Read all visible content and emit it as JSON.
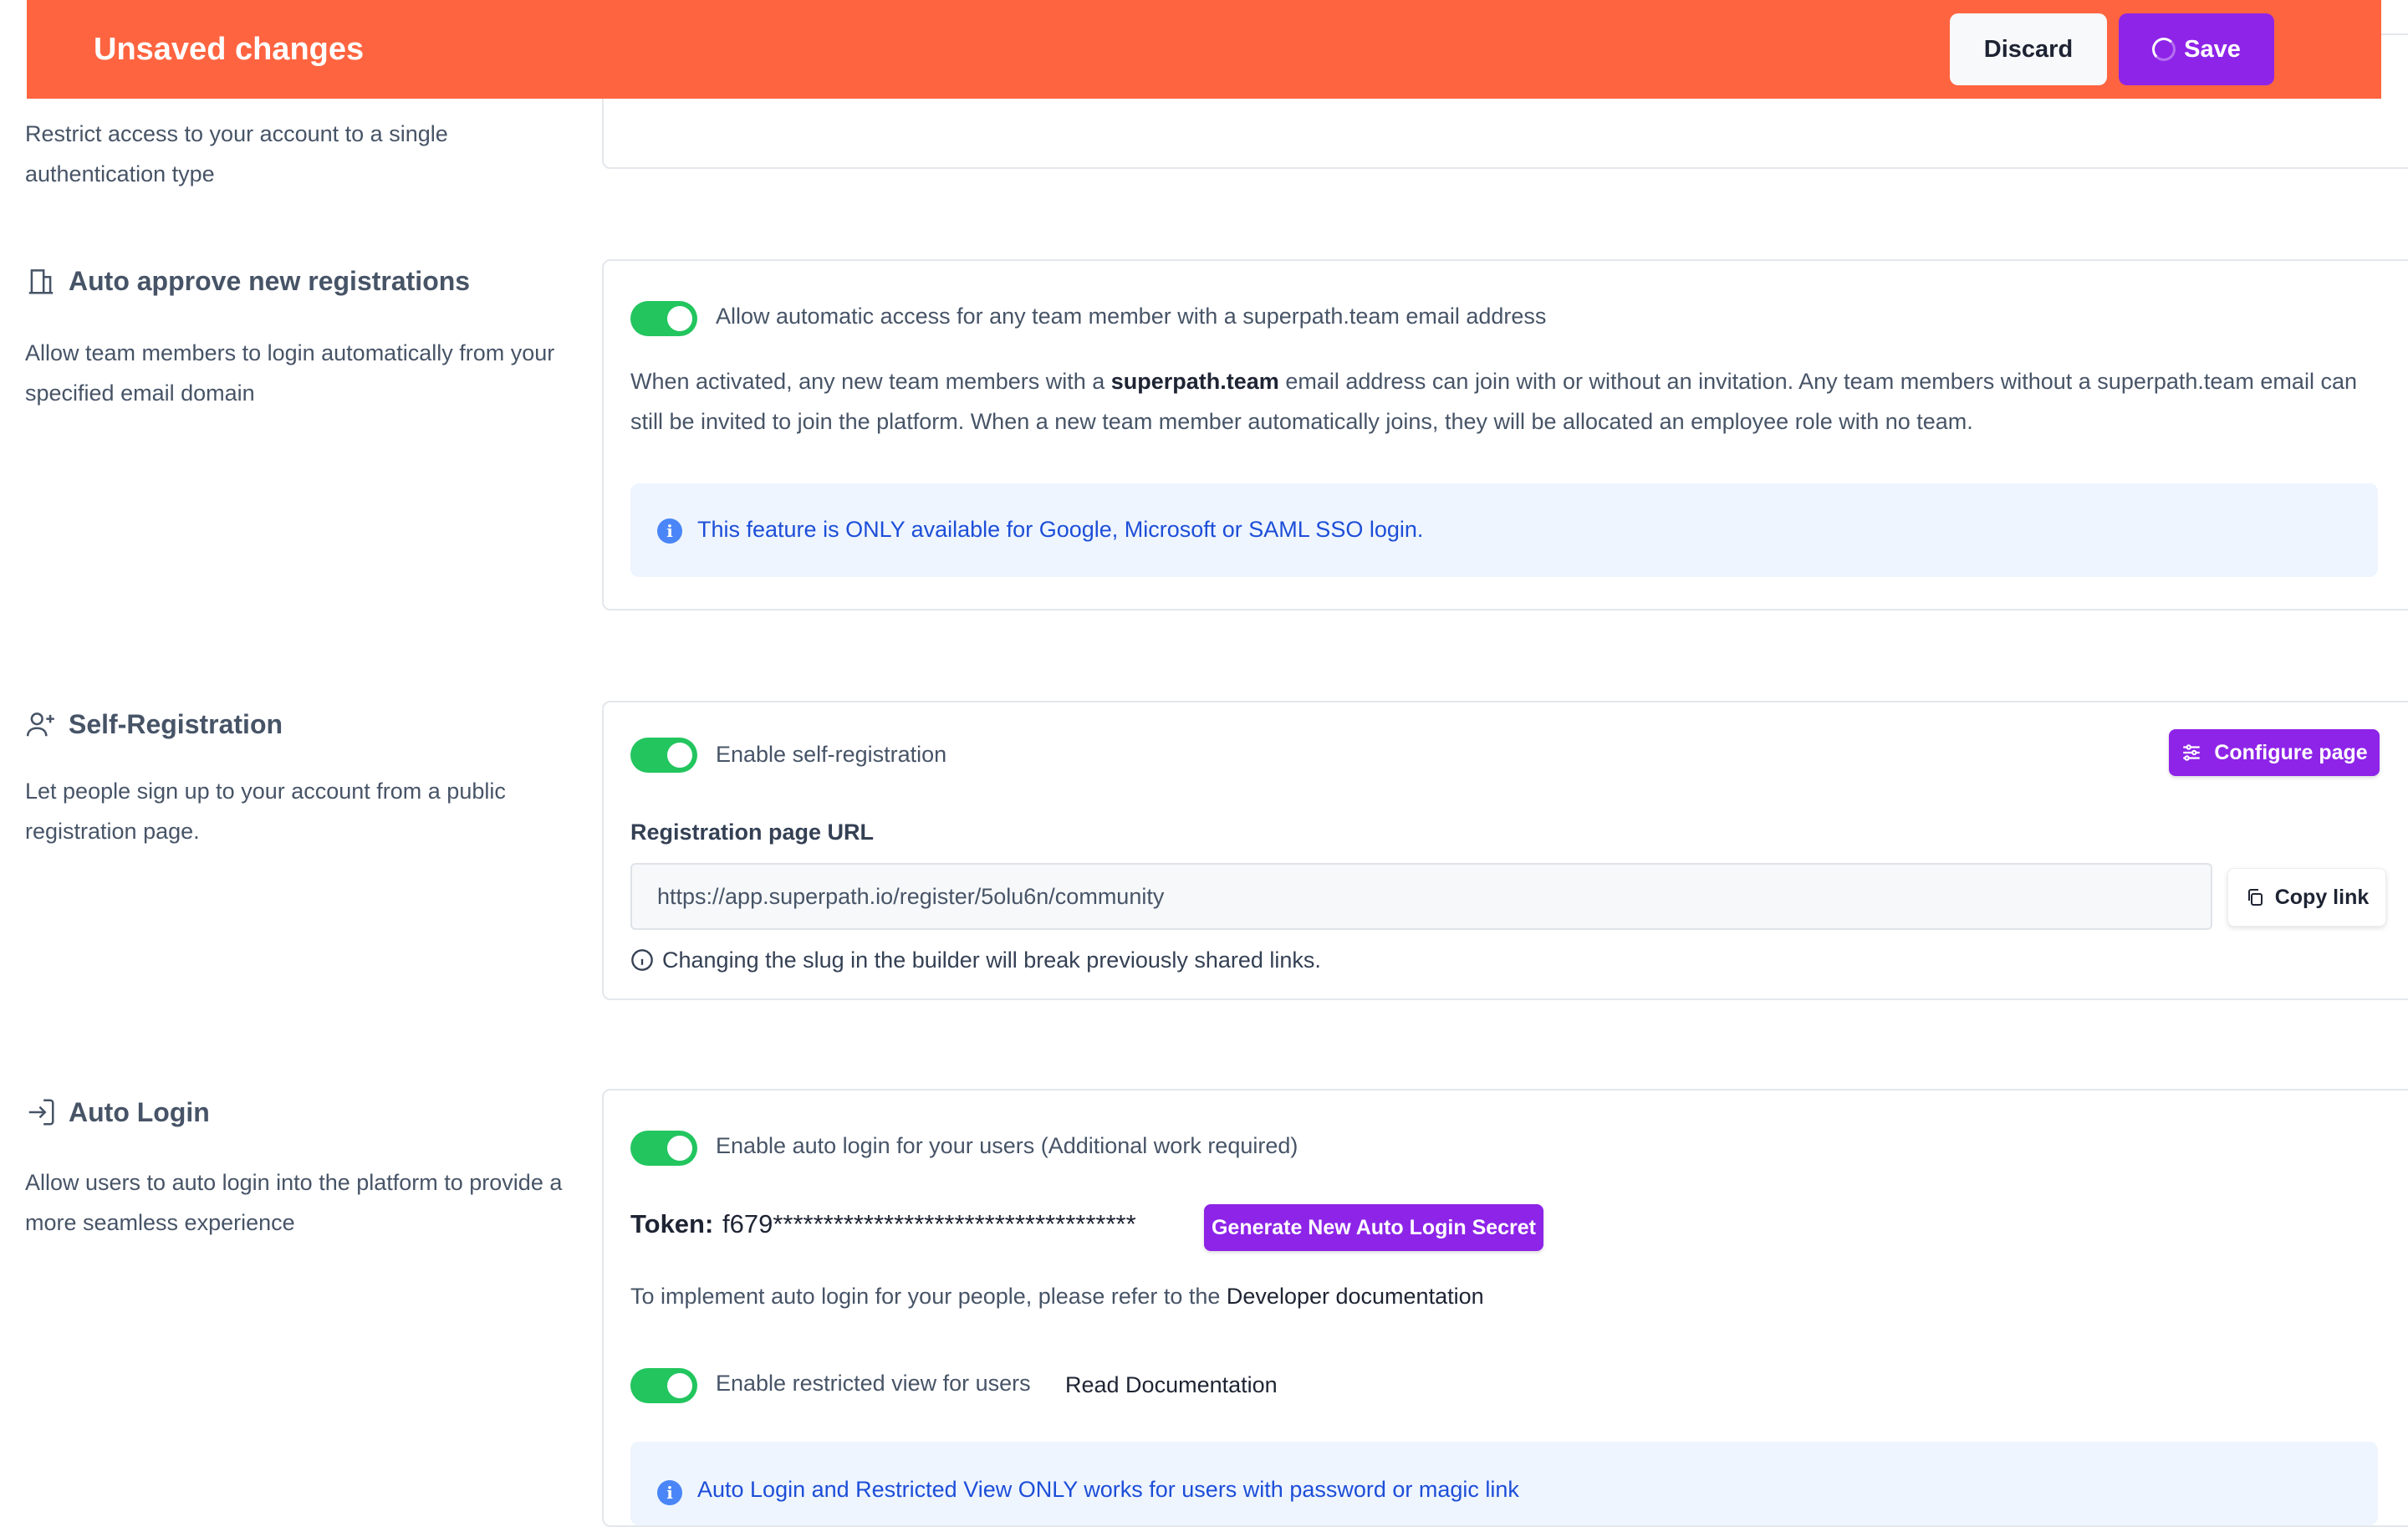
{
  "banner": {
    "title": "Unsaved changes",
    "discard_label": "Discard",
    "save_label": "Save",
    "color": "#ff6440"
  },
  "auth_type": {
    "description": "Restrict access to your account to a single authentication type"
  },
  "auto_approve": {
    "title": "Auto approve new registrations",
    "icon": "building-icon",
    "description": "Allow team members to login automatically from your specified email domain",
    "toggle_label": "Allow automatic access for any team member with a superpath.team email address",
    "toggle_on": true,
    "body_prefix": "When activated, any new team members with a ",
    "body_domain": "superpath.team",
    "body_line1_rest": " email address can join with or without an invitation. Any team members without a superpath.team email can",
    "body_line2": "still be invited to join the platform. When a new team member automatically joins, they will be allocated an employee role with no team.",
    "info": "This feature is ONLY available for Google, Microsoft or SAML SSO login."
  },
  "self_registration": {
    "title": "Self-Registration",
    "icon": "user-plus-icon",
    "description": "Let people sign up to your account from a public registration page.",
    "toggle_label": "Enable self-registration",
    "toggle_on": true,
    "configure_label": "Configure page",
    "url_label": "Registration page URL",
    "url": "https://app.superpath.io/register/5olu6n/community",
    "copy_label": "Copy link",
    "warning": "Changing the slug in the builder will break previously shared links."
  },
  "auto_login": {
    "title": "Auto Login",
    "icon": "login-icon",
    "description": "Allow users to auto login into the platform to provide a more seamless experience",
    "toggle_label": "Enable auto login for your users (Additional work required)",
    "toggle_on": true,
    "token_label": "Token:",
    "token_value": "f679************************************",
    "generate_label": "Generate New Auto Login Secret",
    "docs_prefix": "To implement auto login for your people, please refer to the ",
    "docs_link": "Developer documentation",
    "restricted_label": "Enable restricted view for users",
    "restricted_on": true,
    "read_docs_label": "Read Documentation",
    "info": "Auto Login and Restricted View ONLY works for users with password or magic link"
  },
  "colors": {
    "accent": "#8e24e8",
    "toggle_on": "#22c55e",
    "info_bg": "#eef5ff",
    "info_text": "#1d4ed8"
  }
}
